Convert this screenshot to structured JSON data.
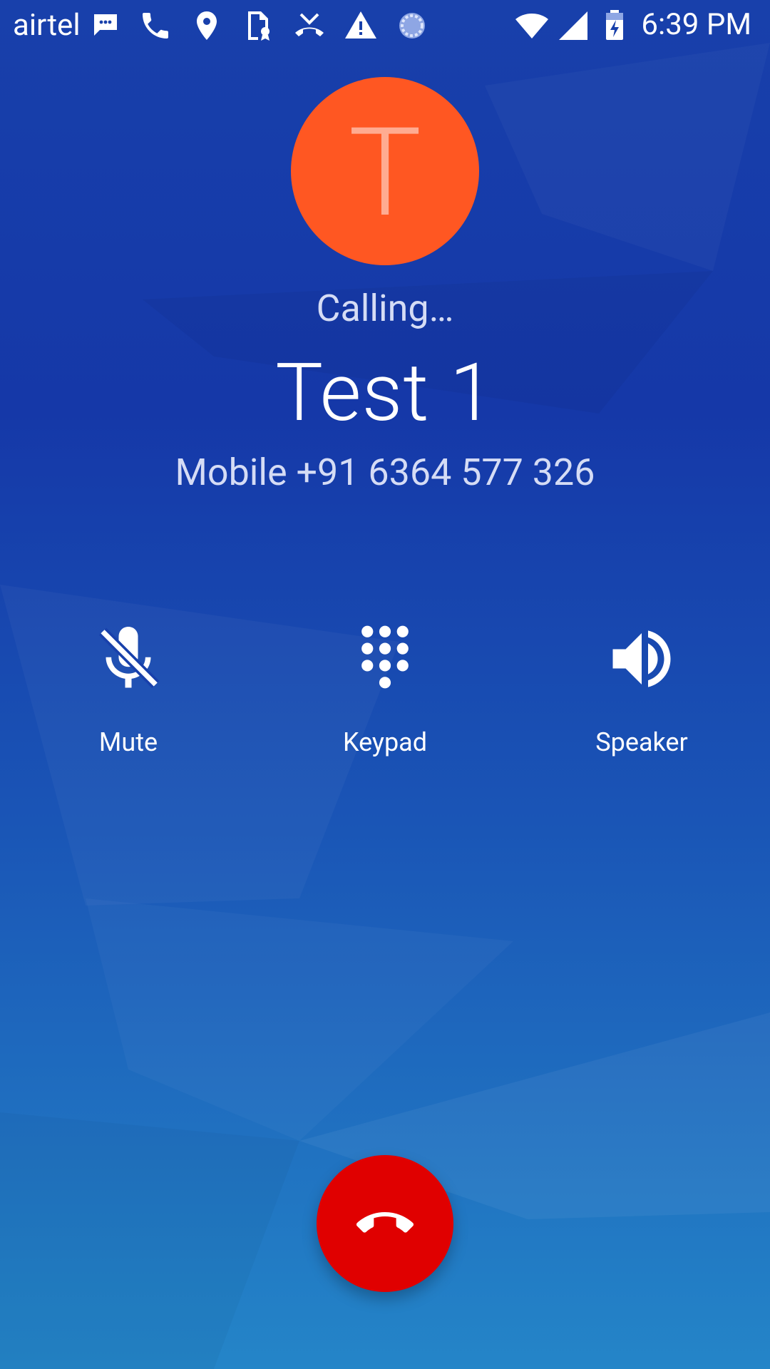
{
  "status_bar": {
    "carrier": "airtel",
    "time": "6:39 PM",
    "icons": [
      "message-icon",
      "phone-icon",
      "location-icon",
      "document-badge-icon",
      "missed-call-icon",
      "warning-icon",
      "sync-icon",
      "wifi-icon",
      "signal-icon",
      "battery-charging-icon"
    ]
  },
  "caller": {
    "avatar_letter": "T",
    "avatar_color": "#ff5722",
    "status": "Calling…",
    "name": "Test 1",
    "number": "Mobile +91 6364 577 326"
  },
  "controls": {
    "mute_label": "Mute",
    "keypad_label": "Keypad",
    "speaker_label": "Speaker"
  },
  "end_call": {
    "color": "#e00000",
    "icon": "end-call-icon"
  }
}
